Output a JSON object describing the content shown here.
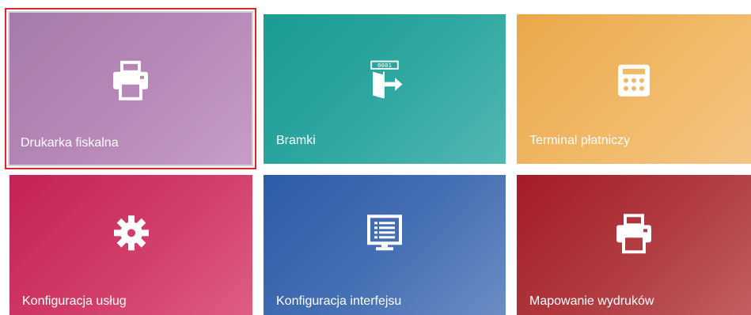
{
  "tiles": [
    {
      "label": "Drukarka fiskalna",
      "icon": "printer-icon",
      "color": "#b889b8",
      "selected": true
    },
    {
      "label": "Bramki",
      "icon": "gate-exit-icon",
      "color": "#2ea7a0",
      "selected": false
    },
    {
      "label": "Terminal płatniczy",
      "icon": "calculator-icon",
      "color": "#f1b968",
      "selected": false
    },
    {
      "label": "Konfiguracja usług",
      "icon": "gear-icon",
      "color": "#d23e69",
      "selected": false
    },
    {
      "label": "Konfiguracja interfejsu",
      "icon": "monitor-list-icon",
      "color": "#4771b5",
      "selected": false
    },
    {
      "label": "Mapowanie wydruków",
      "icon": "printer-icon",
      "color": "#b13c42",
      "selected": false
    }
  ],
  "selection_color": "#e0262a"
}
